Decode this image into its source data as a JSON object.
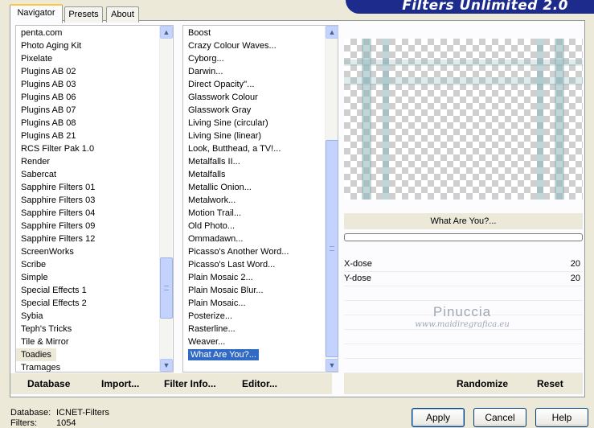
{
  "window_title": "Filters Unlimited 2.0",
  "tabs": [
    {
      "label": "Navigator",
      "active": true
    },
    {
      "label": "Presets",
      "active": false
    },
    {
      "label": "About",
      "active": false
    }
  ],
  "categories": {
    "items": [
      "penta.com",
      "Photo Aging Kit",
      "Pixelate",
      "Plugins AB 02",
      "Plugins AB 03",
      "Plugins AB 06",
      "Plugins AB 07",
      "Plugins AB 08",
      "Plugins AB 21",
      "RCS Filter Pak 1.0",
      "Render",
      "Sabercat",
      "Sapphire Filters 01",
      "Sapphire Filters 03",
      "Sapphire Filters 04",
      "Sapphire Filters 09",
      "Sapphire Filters 12",
      "ScreenWorks",
      "Scribe",
      "Simple",
      "Special Effects 1",
      "Special Effects 2",
      "Sybia",
      "Teph's Tricks",
      "Tile & Mirror",
      "Toadies",
      "Tramages"
    ],
    "selected": "Toadies"
  },
  "filters": {
    "items": [
      "Boost",
      "Crazy Colour Waves...",
      "Cyborg...",
      "Darwin...",
      "Direct Opacity''...",
      "Glasswork Colour",
      "Glasswork Gray",
      "Living Sine (circular)",
      "Living Sine (linear)",
      "Look, Butthead, a TV!...",
      "Metalfalls II...",
      "Metalfalls",
      "Metallic Onion...",
      "Metalwork...",
      "Motion Trail...",
      "Old Photo...",
      "Ommadawn...",
      "Picasso's Another Word...",
      "Picasso's Last Word...",
      "Plain Mosaic 2...",
      "Plain Mosaic Blur...",
      "Plain Mosaic...",
      "Posterize...",
      "Rasterline...",
      "Weaver...",
      "What Are You?..."
    ],
    "selected": "What Are You?..."
  },
  "selected_filter_name": "What Are You?...",
  "progress": 0,
  "params": [
    {
      "label": "X-dose",
      "value": "20"
    },
    {
      "label": "Y-dose",
      "value": "20"
    }
  ],
  "watermark": {
    "line1": "Pinuccia",
    "line2": "www.maidiregrafica.eu"
  },
  "bottom_buttons": {
    "database": "Database",
    "import": "Import...",
    "filter_info": "Filter Info...",
    "editor": "Editor...",
    "randomize": "Randomize",
    "reset": "Reset"
  },
  "status": {
    "database_label": "Database:",
    "database_value": "ICNET-Filters",
    "filters_label": "Filters:",
    "filters_value": "1054"
  },
  "dialog_buttons": {
    "apply": "Apply",
    "cancel": "Cancel",
    "help": "Help"
  },
  "colors": {
    "selection": "#316ac5",
    "title_banner": "#1c2b8c",
    "tab_highlight": "#ffc83c"
  },
  "icons": {
    "scroll_up": "▲",
    "scroll_down": "▼"
  }
}
